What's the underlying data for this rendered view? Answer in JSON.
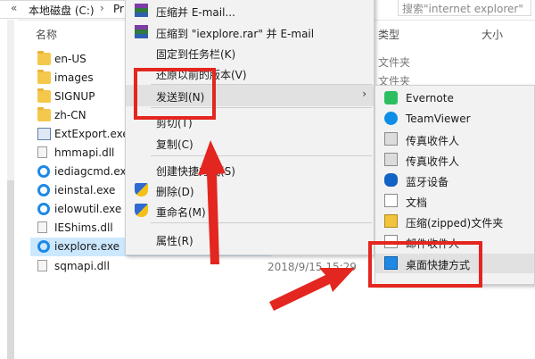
{
  "address": {
    "back_label": "«",
    "path": "本地磁盘 (C:)",
    "separator": "›",
    "path_next": "Pr"
  },
  "search": {
    "placeholder": "搜索\"internet explorer\""
  },
  "columns": {
    "name": "名称",
    "type": "类型",
    "size": "大小"
  },
  "files": [
    {
      "name": "en-US",
      "icon": "folder-icon"
    },
    {
      "name": "images",
      "icon": "folder-icon"
    },
    {
      "name": "SIGNUP",
      "icon": "folder-icon"
    },
    {
      "name": "zh-CN",
      "icon": "folder-icon"
    },
    {
      "name": "ExtExport.exe",
      "icon": "exe-icon"
    },
    {
      "name": "hmmapi.dll",
      "icon": "dll-icon"
    },
    {
      "name": "iediagcmd.exe",
      "icon": "ie-icon"
    },
    {
      "name": "ieinstal.exe",
      "icon": "ie-icon"
    },
    {
      "name": "ielowutil.exe",
      "icon": "ie-icon"
    },
    {
      "name": "IEShims.dll",
      "icon": "dll-icon"
    },
    {
      "name": "iexplore.exe",
      "icon": "ie-icon",
      "selected": true
    },
    {
      "name": "sqmapi.dll",
      "icon": "dll-icon"
    }
  ],
  "details": {
    "folder_type_1": "文件夹",
    "folder_type_2": "文件夹",
    "date_last": "2018/9/15 15:29"
  },
  "context_menu": {
    "items": [
      {
        "label": "压缩并 E-mail...",
        "icon": "winrar-icon"
      },
      {
        "label": "压缩到 \"iexplore.rar\" 并 E-mail",
        "icon": "winrar-icon"
      },
      {
        "label": "固定到任务栏(K)",
        "icon": ""
      },
      {
        "label": "还原以前的版本(V)",
        "icon": ""
      },
      {
        "label": "发送到(N)",
        "icon": "",
        "submenu": true
      },
      {
        "label": "剪切(T)",
        "icon": ""
      },
      {
        "label": "复制(C)",
        "icon": ""
      },
      {
        "label": "创建快捷方式(S)",
        "icon": ""
      },
      {
        "label": "删除(D)",
        "icon": "shield-icon"
      },
      {
        "label": "重命名(M)",
        "icon": "shield-icon"
      },
      {
        "label": "属性(R)",
        "icon": ""
      }
    ],
    "submenu_arrow": "›"
  },
  "sendto_menu": {
    "items": [
      {
        "label": "Evernote",
        "icon": "evernote-icon"
      },
      {
        "label": "TeamViewer",
        "icon": "teamviewer-icon"
      },
      {
        "label": "传真收件人",
        "icon": "fax-icon"
      },
      {
        "label": "传真收件人",
        "icon": "fax-icon"
      },
      {
        "label": "蓝牙设备",
        "icon": "bluetooth-icon"
      },
      {
        "label": "文档",
        "icon": "document-icon"
      },
      {
        "label": "压缩(zipped)文件夹",
        "icon": "zip-folder-icon"
      },
      {
        "label": "邮件收件人",
        "icon": "mail-icon"
      },
      {
        "label": "桌面快捷方式",
        "icon": "desktop-icon"
      }
    ]
  },
  "annotation_color": "#e3261f"
}
